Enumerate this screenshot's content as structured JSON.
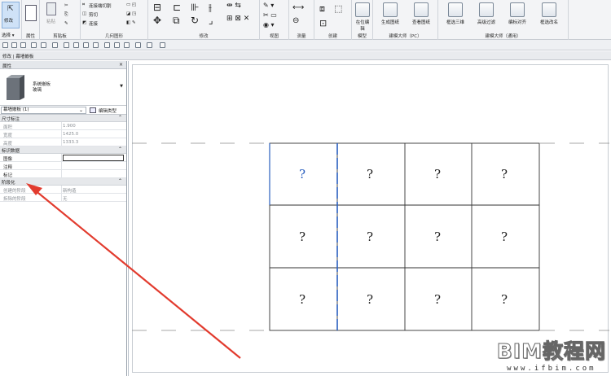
{
  "ribbon": {
    "modify_label": "修改",
    "select_label": "选择 ▾",
    "properties_label": "属性",
    "clipboard_label": "剪贴板",
    "paste_label": "粘贴",
    "geometry_label": "几何图形",
    "modify_panel_label": "修改",
    "view_label": "视图",
    "measure_label": "测量",
    "create_label": "创建",
    "model_label": "模型",
    "pc_label": "建模大师（PC）",
    "general_label": "建模大师（通用）",
    "join_label": "连接端切割",
    "cut_label": "剪切",
    "connect_label": "连接",
    "buttons": [
      {
        "label": "在位编辑",
        "id": "inplace"
      },
      {
        "label": "生成图纸",
        "id": "gen-sheet"
      },
      {
        "label": "查看图纸",
        "id": "view-sheet"
      },
      {
        "label": "框选三维",
        "id": "box3d"
      },
      {
        "label": "高级过滤",
        "id": "adv-filter"
      },
      {
        "label": "编标对齐",
        "id": "align"
      },
      {
        "label": "框选改名",
        "id": "rename"
      }
    ]
  },
  "context_bar": {
    "text": "修改 | 幕墙嵌板"
  },
  "properties": {
    "title": "属性",
    "close": "×",
    "type_family": "系统嵌板",
    "type_name": "玻璃",
    "selector_value": "幕墙嵌板 (1)",
    "edit_type_label": "编辑类型",
    "groups": [
      {
        "name": "尺寸标注",
        "rows": [
          {
            "key": "面积",
            "value": "1.900",
            "editable": false
          },
          {
            "key": "宽度",
            "value": "1425.0",
            "editable": false
          },
          {
            "key": "高度",
            "value": "1333.3",
            "editable": false
          }
        ]
      },
      {
        "name": "标识数据",
        "rows": [
          {
            "key": "图像",
            "value": "",
            "editable": true,
            "input": true
          },
          {
            "key": "注释",
            "value": "",
            "editable": true
          },
          {
            "key": "标记",
            "value": "",
            "editable": true
          }
        ]
      },
      {
        "name": "阶段化",
        "rows": [
          {
            "key": "创建的阶段",
            "value": "新构造",
            "editable": false
          },
          {
            "key": "拆除的阶段",
            "value": "无",
            "editable": false
          }
        ]
      }
    ]
  },
  "canvas": {
    "panel_symbol": "?",
    "grid_rows": 3,
    "grid_cols": 4
  },
  "watermark": {
    "title": "BIM教程网",
    "url": "www.ifbim.com"
  },
  "colors": {
    "arrow": "#e23b2e",
    "selection": "#2a5fbf",
    "ribbon_bg": "#f3f4f6"
  }
}
